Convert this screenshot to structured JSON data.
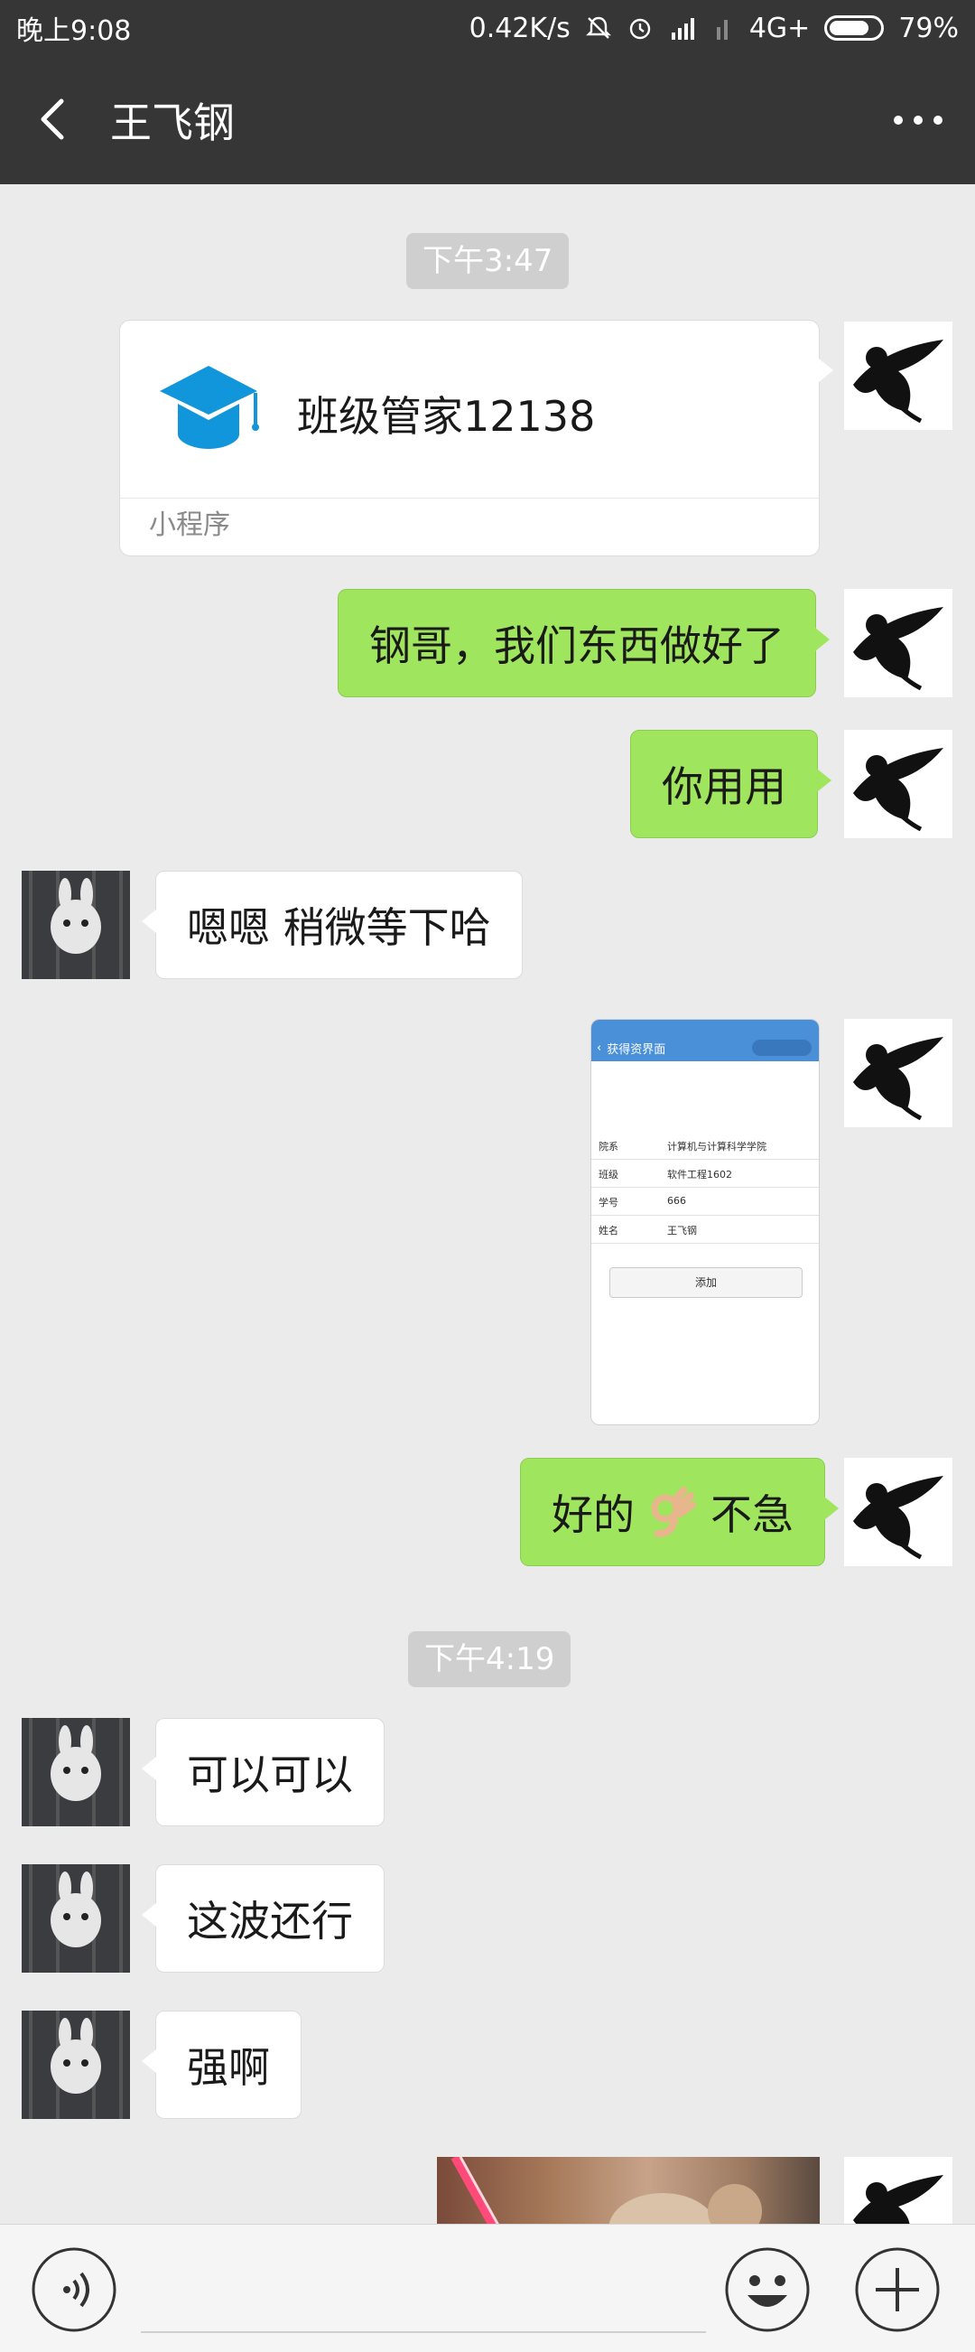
{
  "status_bar": {
    "time": "晚上9:08",
    "net_speed": "0.42K/s",
    "network_type": "4G+",
    "battery_percent": "79%",
    "battery_level": 0.79
  },
  "header": {
    "title": "王飞钢"
  },
  "messages": {
    "ts1": "下午3:47",
    "mini_program": {
      "name": "班级管家12138",
      "footer": "小程序"
    },
    "m1": "钢哥，我们东西做好了",
    "m2": "你用用",
    "m3": "嗯嗯 稍微等下哈",
    "screenshot": {
      "nav_title": "获得资界面",
      "rows": [
        {
          "k": "院系",
          "v": "计算机与计算科学学院"
        },
        {
          "k": "班级",
          "v": "软件工程1602"
        },
        {
          "k": "学号",
          "v": "666"
        },
        {
          "k": "姓名",
          "v": "王飞钢"
        }
      ],
      "button": "添加"
    },
    "m4_a": "好的",
    "m4_b": "不急",
    "ts2": "下午4:19",
    "m5": "可以可以",
    "m6": "这波还行",
    "m7": "强啊"
  },
  "input_bar": {
    "placeholder": ""
  },
  "icons": {
    "back": "back-arrow-icon",
    "more": "more-dots-icon",
    "voice": "voice-icon",
    "emoji": "emoji-icon",
    "plus": "plus-icon"
  },
  "colors": {
    "header_bg": "#363636",
    "chat_bg": "#ebebeb",
    "my_bubble": "#9fe65e",
    "other_bubble": "#ffffff"
  }
}
